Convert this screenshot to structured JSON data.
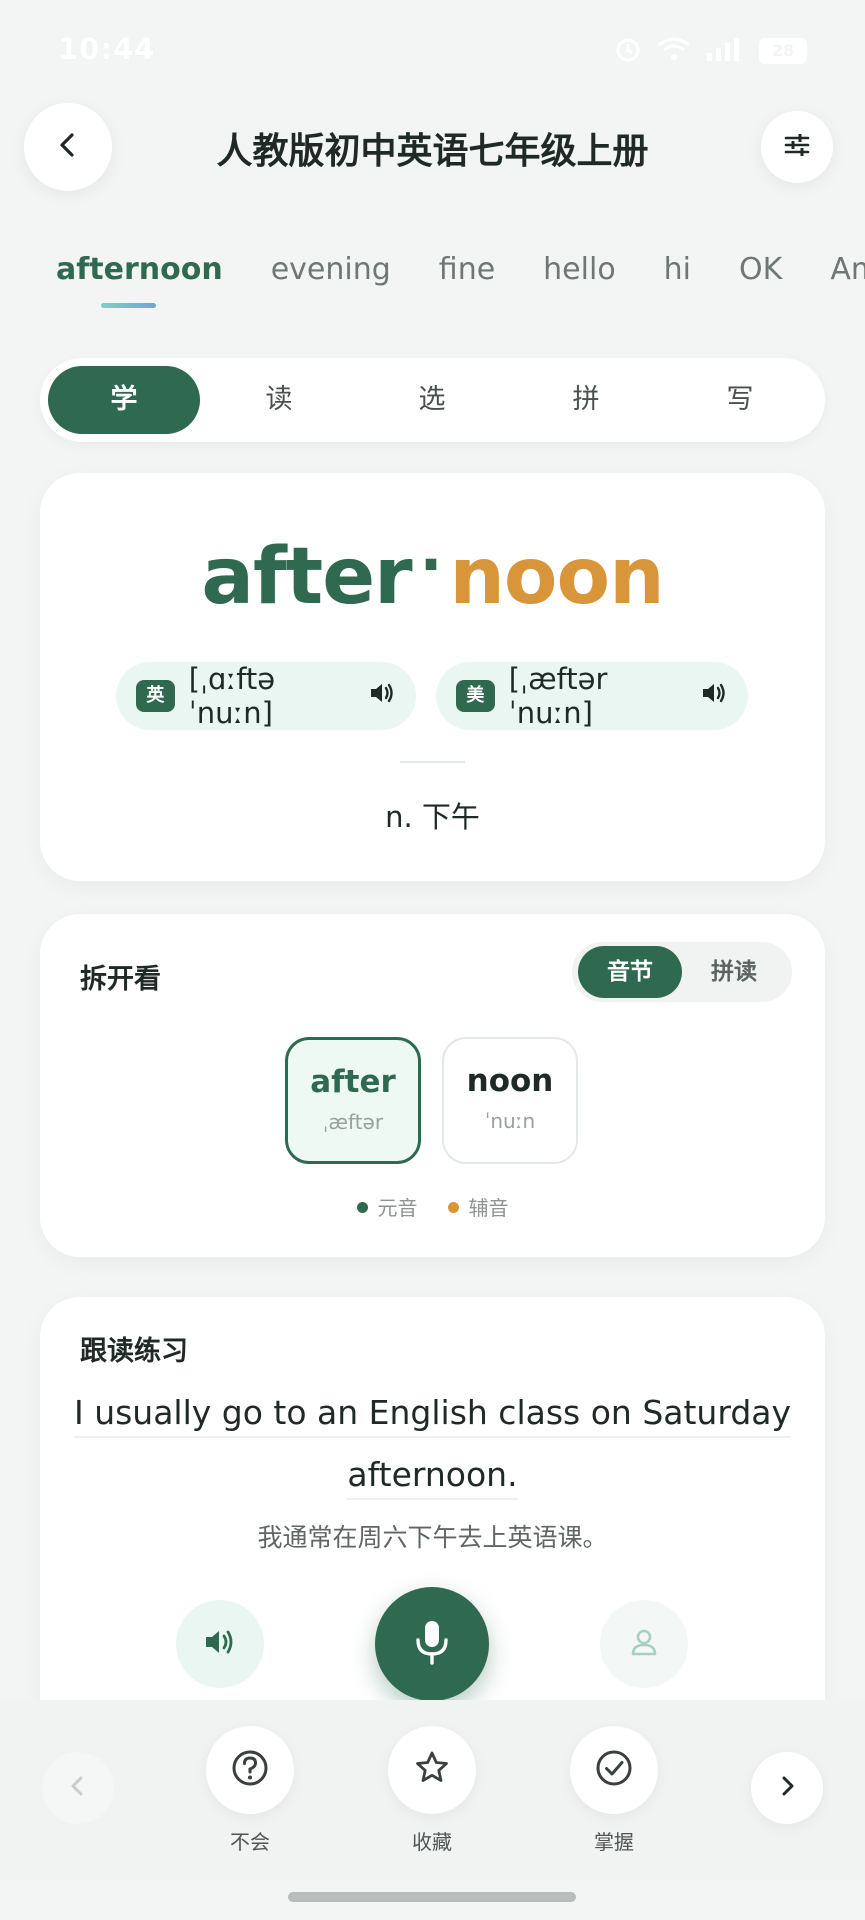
{
  "status_bar": {
    "time": "10:44",
    "battery": "28"
  },
  "header": {
    "title": "人教版初中英语七年级上册"
  },
  "word_tabs": [
    {
      "label": "afternoon",
      "active": true
    },
    {
      "label": "evening",
      "active": false
    },
    {
      "label": "fine",
      "active": false
    },
    {
      "label": "hello",
      "active": false
    },
    {
      "label": "hi",
      "active": false
    },
    {
      "label": "OK",
      "active": false
    },
    {
      "label": "Am",
      "active": false
    }
  ],
  "modes": [
    {
      "label": "学",
      "active": true
    },
    {
      "label": "读",
      "active": false
    },
    {
      "label": "选",
      "active": false
    },
    {
      "label": "拼",
      "active": false
    },
    {
      "label": "写",
      "active": false
    }
  ],
  "word_card": {
    "part1": "after",
    "separator": "·",
    "part2": "noon",
    "uk_badge": "英",
    "uk_phonetic": "[ˌɑːftəˈnuːn]",
    "us_badge": "美",
    "us_phonetic": "[ˌæftərˈnuːn]",
    "meaning": "n. 下午"
  },
  "split_card": {
    "title": "拆开看",
    "toggle": [
      "音节",
      "拼读"
    ],
    "syllables": [
      {
        "word": "after",
        "ipa": "ˌæftər"
      },
      {
        "word": "noon",
        "ipa": "ˈnuːn"
      }
    ],
    "legend": [
      {
        "label": "元音",
        "color": "#2f6a50"
      },
      {
        "label": "辅音",
        "color": "#d9953a"
      }
    ]
  },
  "follow_card": {
    "title": "跟读练习",
    "sentence_line1": "I usually go to an English class on Saturday",
    "sentence_line2": "afternoon.",
    "translation": "我通常在周六下午去上英语课。"
  },
  "bottom_actions": [
    {
      "label": "不会",
      "icon": "question-icon"
    },
    {
      "label": "收藏",
      "icon": "star-icon"
    },
    {
      "label": "掌握",
      "icon": "check-circle-icon"
    }
  ],
  "colors": {
    "primary": "#2f6a50",
    "accent": "#d9953a",
    "background": "#f3f5f4"
  }
}
